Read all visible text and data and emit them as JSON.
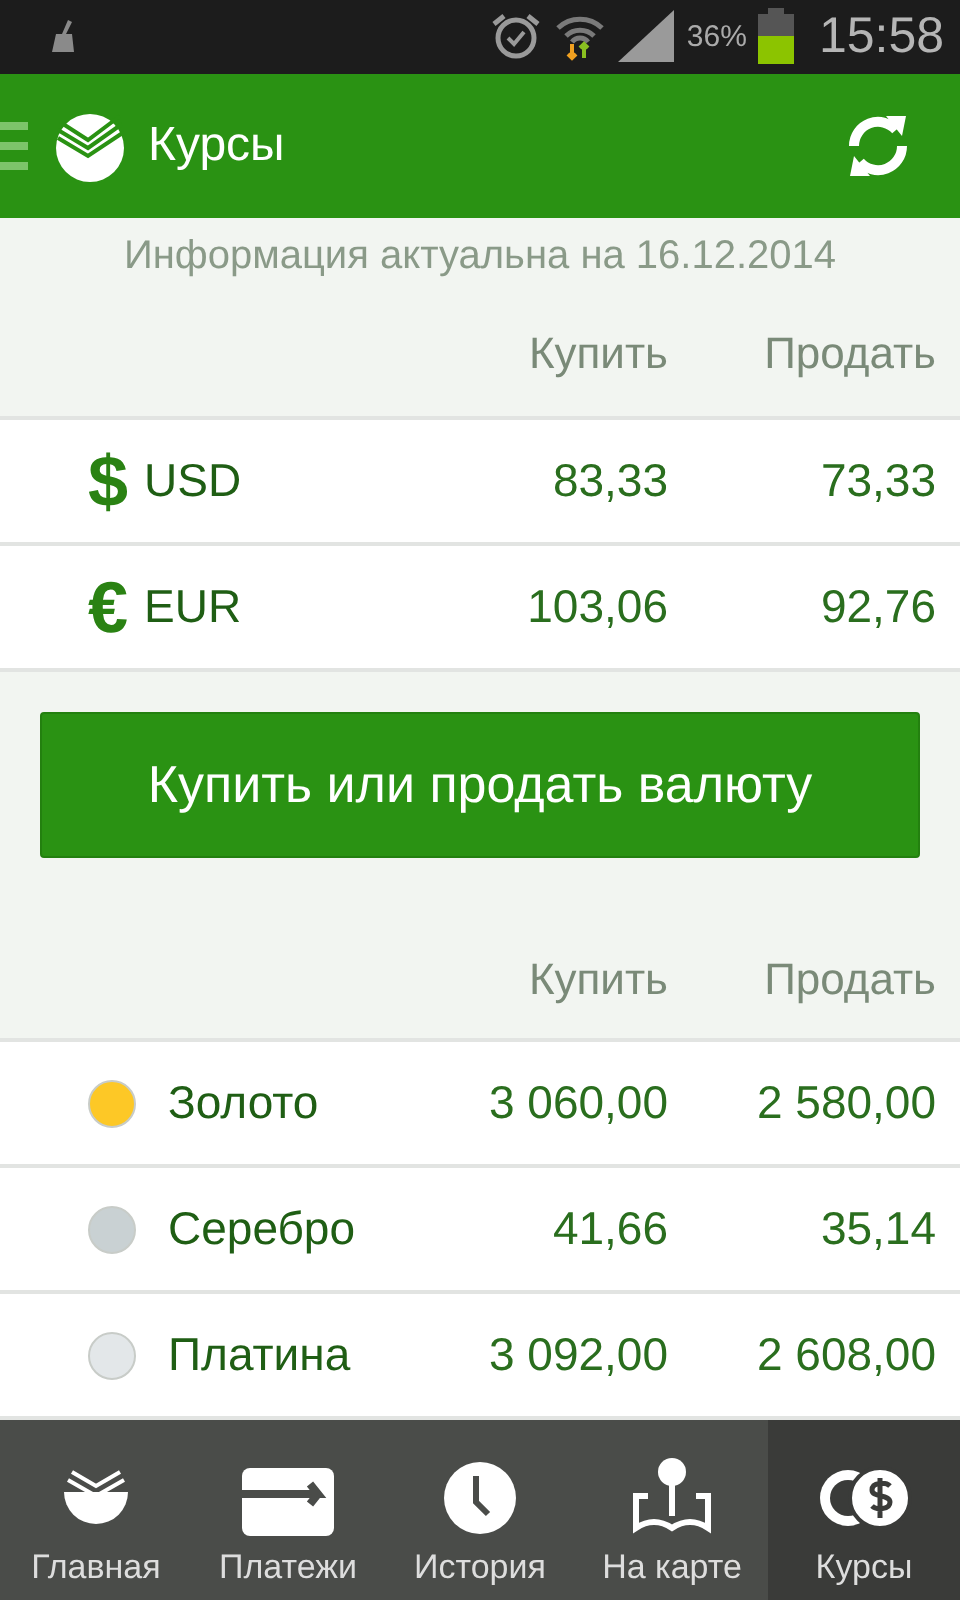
{
  "status_bar": {
    "battery_text": "36%",
    "time": "15:58"
  },
  "app_bar": {
    "title": "Курсы"
  },
  "info": "Информация актуальна на 16.12.2014",
  "currencies": {
    "columns": [
      "Купить",
      "Продать"
    ],
    "rows": [
      {
        "symbol": "$",
        "code": "USD",
        "buy": "83,33",
        "sell": "73,33"
      },
      {
        "symbol": "€",
        "code": "EUR",
        "buy": "103,06",
        "sell": "92,76"
      }
    ]
  },
  "action_button": "Купить или продать валюту",
  "metals": {
    "columns": [
      "Купить",
      "Продать"
    ],
    "rows": [
      {
        "name": "Золото",
        "color": "#fdc826",
        "buy": "3 060,00",
        "sell": "2 580,00"
      },
      {
        "name": "Серебро",
        "color": "#c9d1d3",
        "buy": "41,66",
        "sell": "35,14"
      },
      {
        "name": "Платина",
        "color": "#e3e7e9",
        "buy": "3 092,00",
        "sell": "2 608,00"
      }
    ]
  },
  "nav": [
    {
      "kind": "home",
      "label": "Главная",
      "selected": false
    },
    {
      "kind": "payments",
      "label": "Платежи",
      "selected": false
    },
    {
      "kind": "history",
      "label": "История",
      "selected": false
    },
    {
      "kind": "map",
      "label": "На карте",
      "selected": false
    },
    {
      "kind": "rates",
      "label": "Курсы",
      "selected": true
    }
  ]
}
